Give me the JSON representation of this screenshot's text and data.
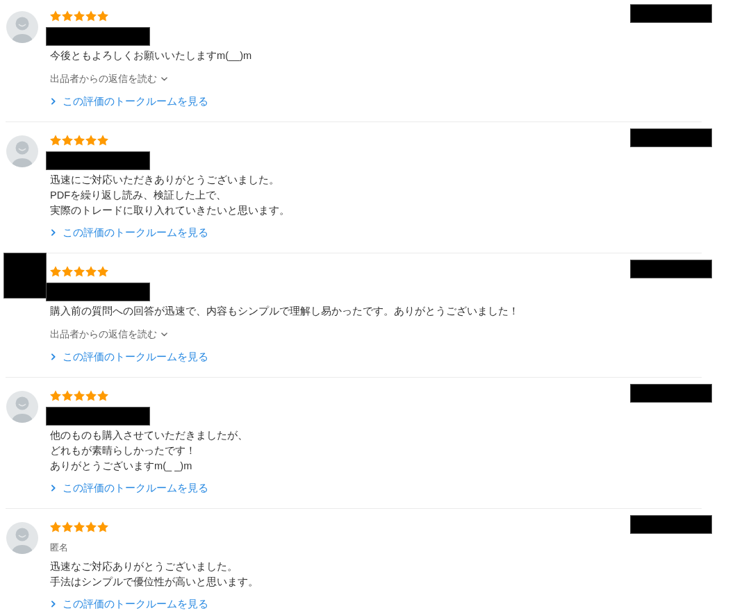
{
  "reviews": [
    {
      "avatar_redacted": false,
      "stars": 5,
      "reviewer": {
        "kind": "redacted"
      },
      "date_redacted": true,
      "comment": [
        "今後ともよろしくお願いいたしますm(__)m"
      ],
      "reply_toggle": "出品者からの返信を読む",
      "talkroom_link": "この評価のトークルームを見る"
    },
    {
      "avatar_redacted": false,
      "stars": 5,
      "reviewer": {
        "kind": "redacted"
      },
      "date_redacted": true,
      "comment": [
        "迅速にご対応いただきありがとうございました。",
        "PDFを繰り返し読み、検証した上で、",
        "実際のトレードに取り入れていきたいと思います。"
      ],
      "talkroom_link": "この評価のトークルームを見る"
    },
    {
      "avatar_redacted": true,
      "stars": 5,
      "reviewer": {
        "kind": "redacted"
      },
      "date_redacted": true,
      "comment": [
        "購入前の質問への回答が迅速で、内容もシンプルで理解し易かったです。ありがとうございました！"
      ],
      "reply_toggle": "出品者からの返信を読む",
      "talkroom_link": "この評価のトークルームを見る"
    },
    {
      "avatar_redacted": false,
      "stars": 5,
      "reviewer": {
        "kind": "redacted"
      },
      "date_redacted": true,
      "comment": [
        "他のものも購入させていただきましたが、",
        "どれもが素晴らしかったです！",
        "ありがとうございますm(_ _)m"
      ],
      "talkroom_link": "この評価のトークルームを見る"
    },
    {
      "avatar_redacted": false,
      "stars": 5,
      "reviewer": {
        "kind": "text",
        "name": "匿名"
      },
      "date_redacted": true,
      "comment": [
        "迅速なご対応ありがとうございました。",
        "手法はシンプルで優位性が高いと思います。"
      ],
      "talkroom_link": "この評価のトークルームを見る"
    }
  ]
}
